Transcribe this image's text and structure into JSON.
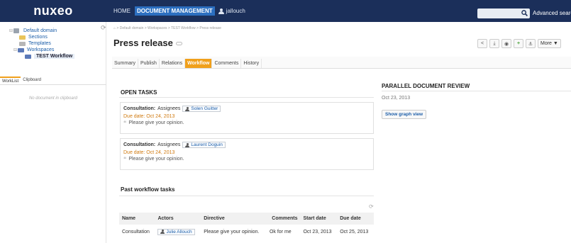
{
  "header": {
    "logo": "nuxeo",
    "nav": [
      {
        "label": "HOME",
        "active": false
      },
      {
        "label": "DOCUMENT MANAGEMENT",
        "active": true
      }
    ],
    "user": "jallouch",
    "search_placeholder": "",
    "advanced_search": "Advanced search"
  },
  "sidebar": {
    "tree": [
      {
        "label": "Default domain",
        "icon": "domain-icon",
        "level": 0
      },
      {
        "label": "Sections",
        "icon": "folder-icon",
        "level": 1
      },
      {
        "label": "Templates",
        "icon": "folder-icon",
        "level": 1
      },
      {
        "label": "Workspaces",
        "icon": "folder-icon",
        "level": 1
      },
      {
        "label": "TEST Workflow",
        "icon": "folder-icon",
        "level": 2,
        "selected": true
      }
    ],
    "tabs": [
      {
        "label": "WorkList",
        "active": true
      },
      {
        "label": "Clipboard",
        "active": false
      }
    ],
    "empty_message": "No document in clipboard"
  },
  "main": {
    "breadcrumb": "> Default domain > Workspaces > TEST Workflow > Press release",
    "title": "Press release",
    "more_label": "More ▼",
    "tabs": [
      {
        "label": "Summary",
        "active": false
      },
      {
        "label": "Publish",
        "active": false
      },
      {
        "label": "Relations",
        "active": false
      },
      {
        "label": "Workflow",
        "active": true
      },
      {
        "label": "Comments",
        "active": false
      },
      {
        "label": "History",
        "active": false
      }
    ],
    "open_tasks_title": "OPEN TASKS",
    "tasks": [
      {
        "name": "Consultation:",
        "assignees_label": "Assignees",
        "assignee": "Solen Guitter",
        "due": "Due date: Oct 24, 2013",
        "comment": "Please give your opinion."
      },
      {
        "name": "Consultation:",
        "assignees_label": "Assignees",
        "assignee": "Laurent Doguin",
        "due": "Due date: Oct 24, 2013",
        "comment": "Please give your opinion."
      }
    ],
    "past_title": "Past workflow tasks",
    "past_table": {
      "headers": [
        "Name",
        "Actors",
        "Directive",
        "Comments",
        "Start date",
        "Due date"
      ],
      "rows": [
        [
          "Consultation",
          "Julie Allouch",
          "Please give your opinion.",
          "Ok for me",
          "Oct 23, 2013",
          "Oct 25, 2013"
        ]
      ]
    },
    "parallel": {
      "title": "PARALLEL DOCUMENT REVIEW",
      "date": "Oct 23, 2013",
      "graph_button": "Show graph view"
    }
  },
  "colors": {
    "header_bg": "#1b2f5a",
    "active_nav": "#2c6fc0",
    "active_tab": "#f0a01c",
    "due_date": "#d07a10",
    "link": "#1b5da8"
  }
}
